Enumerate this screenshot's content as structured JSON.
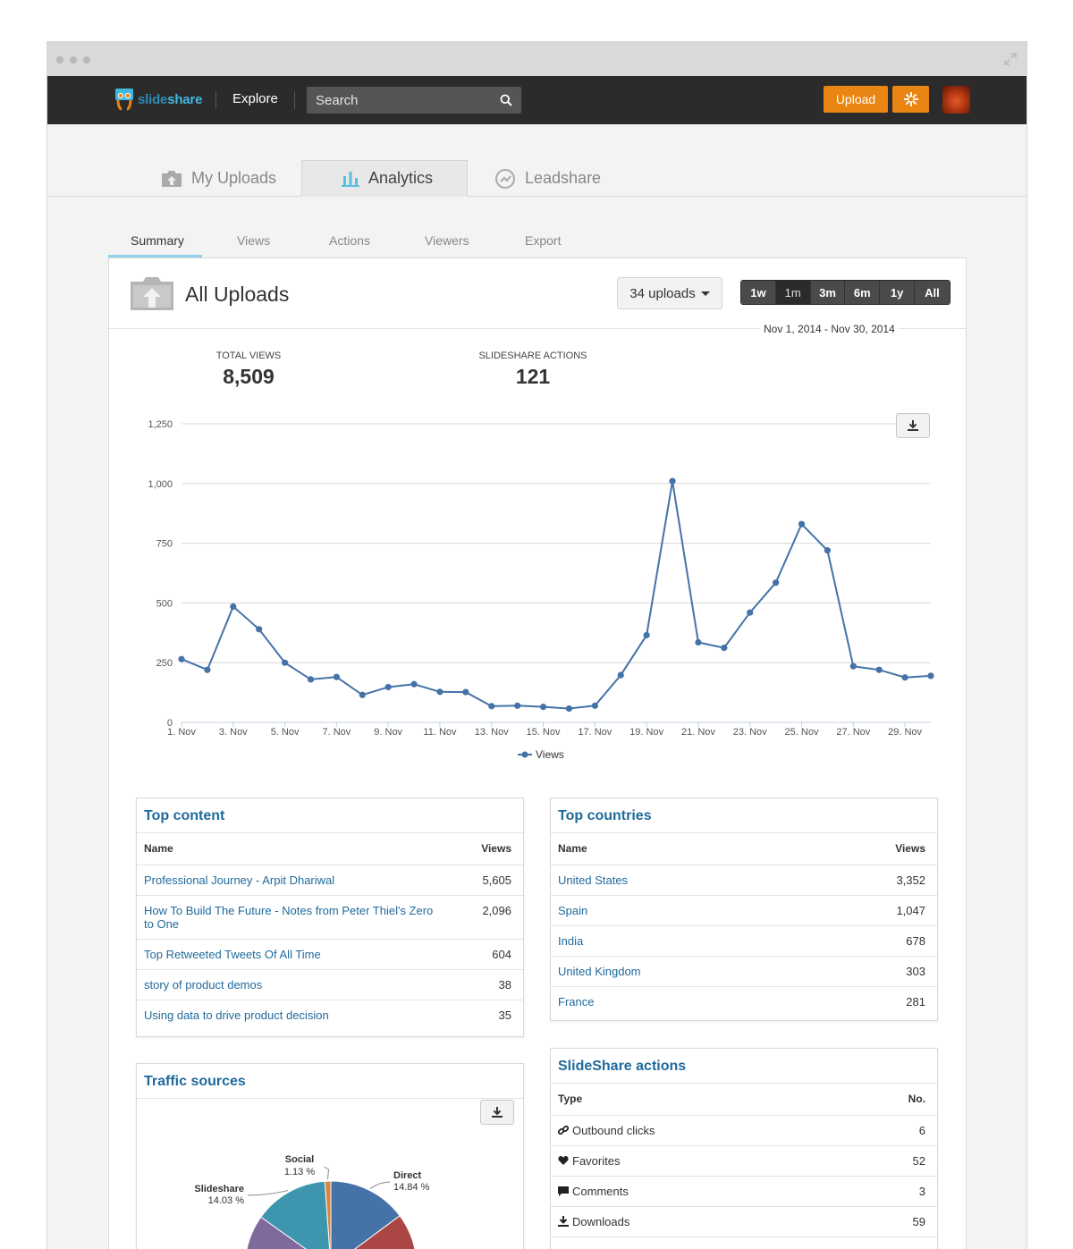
{
  "nav": {
    "logo": {
      "part1": "slide",
      "part2": "share"
    },
    "explore": "Explore",
    "search_placeholder": "Search",
    "upload": "Upload"
  },
  "main_tabs": [
    {
      "label": "My Uploads",
      "icon": "upload-tray-icon"
    },
    {
      "label": "Analytics",
      "icon": "bar-chart-icon",
      "active": true
    },
    {
      "label": "Leadshare",
      "icon": "leadshare-icon"
    }
  ],
  "sub_tabs": [
    {
      "label": "Summary",
      "active": true
    },
    {
      "label": "Views"
    },
    {
      "label": "Actions"
    },
    {
      "label": "Viewers"
    },
    {
      "label": "Export"
    }
  ],
  "panel": {
    "title": "All Uploads",
    "uploads_dropdown": "34 uploads",
    "ranges": [
      {
        "label": "1w"
      },
      {
        "label": "1m",
        "active": true
      },
      {
        "label": "3m"
      },
      {
        "label": "6m"
      },
      {
        "label": "1y"
      },
      {
        "label": "All"
      }
    ],
    "date_range": "Nov 1, 2014 - Nov 30, 2014",
    "stats": {
      "total_views_label": "TOTAL VIEWS",
      "total_views": "8,509",
      "actions_label": "SLIDESHARE ACTIONS",
      "actions": "121"
    }
  },
  "chart_data": {
    "type": "line",
    "xlabel": "",
    "ylabel": "",
    "ylim": [
      0,
      1250
    ],
    "y_ticks": [
      "0",
      "250",
      "500",
      "750",
      "1,000",
      "1,250"
    ],
    "x_tick_labels": [
      "1. Nov",
      "3. Nov",
      "5. Nov",
      "7. Nov",
      "9. Nov",
      "11. Nov",
      "13. Nov",
      "15. Nov",
      "17. Nov",
      "19. Nov",
      "21. Nov",
      "23. Nov",
      "25. Nov",
      "27. Nov",
      "29. Nov"
    ],
    "x": [
      1,
      2,
      3,
      4,
      5,
      6,
      7,
      8,
      9,
      10,
      11,
      12,
      13,
      14,
      15,
      16,
      17,
      18,
      19,
      20,
      21,
      22,
      23,
      24,
      25,
      26,
      27,
      28,
      29,
      30
    ],
    "series": [
      {
        "name": "Views",
        "color": "#4572a7",
        "values": [
          265,
          220,
          485,
          390,
          250,
          180,
          190,
          115,
          148,
          160,
          128,
          127,
          68,
          70,
          65,
          58,
          70,
          198,
          365,
          1010,
          335,
          312,
          460,
          585,
          830,
          720,
          235,
          220,
          188,
          195
        ]
      }
    ],
    "legend": "bottom-center",
    "grid": true
  },
  "top_content": {
    "title": "Top content",
    "col_name": "Name",
    "col_views": "Views",
    "rows": [
      {
        "name": "Professional Journey - Arpit Dhariwal",
        "views": "5,605"
      },
      {
        "name": "How To Build The Future - Notes from Peter Thiel's Zero to One",
        "views": "2,096"
      },
      {
        "name": "Top Retweeted Tweets Of All Time",
        "views": "604"
      },
      {
        "name": "story of product demos",
        "views": "38"
      },
      {
        "name": "Using data to drive product decision",
        "views": "35"
      }
    ]
  },
  "top_countries": {
    "title": "Top countries",
    "col_name": "Name",
    "col_views": "Views",
    "rows": [
      {
        "name": "United States",
        "views": "3,352"
      },
      {
        "name": "Spain",
        "views": "1,047"
      },
      {
        "name": "India",
        "views": "678"
      },
      {
        "name": "United Kingdom",
        "views": "303"
      },
      {
        "name": "France",
        "views": "281"
      }
    ]
  },
  "traffic_sources": {
    "title": "Traffic sources",
    "slices": [
      {
        "name": "Direct",
        "pct": "14.84 %",
        "value": 14.84,
        "color": "#4572a7"
      },
      {
        "name": "Social",
        "pct": "1.13 %",
        "value": 1.13,
        "color": "#db843d"
      },
      {
        "name": "Slideshare",
        "pct": "14.03 %",
        "value": 14.03,
        "color": "#3d96ae"
      }
    ]
  },
  "actions": {
    "title": "SlideShare actions",
    "col_type": "Type",
    "col_no": "No.",
    "rows": [
      {
        "type": "Outbound clicks",
        "icon": "link-icon",
        "no": "6"
      },
      {
        "type": "Favorites",
        "icon": "heart-icon",
        "no": "52"
      },
      {
        "type": "Comments",
        "icon": "comment-icon",
        "no": "3"
      },
      {
        "type": "Downloads",
        "icon": "download-icon",
        "no": "59"
      }
    ]
  }
}
